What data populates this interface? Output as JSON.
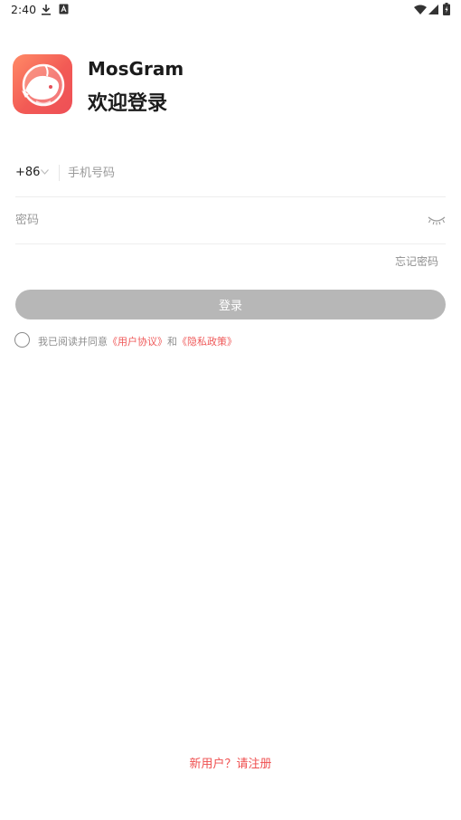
{
  "status_bar": {
    "time": "2:40",
    "left_icons": [
      "download-icon",
      "keyboard-a-icon"
    ],
    "right_icons": [
      "wifi-icon",
      "signal-icon",
      "battery-charging-icon"
    ]
  },
  "header": {
    "app_name": "MosGram",
    "welcome": "欢迎登录",
    "logo_colors": [
      "#ff8a66",
      "#ee4f57"
    ]
  },
  "form": {
    "country_code": "+86",
    "phone_placeholder": "手机号码",
    "password_placeholder": "密码",
    "forgot_password": "忘记密码",
    "login_label": "登录",
    "login_button_color": "#b7b7b7"
  },
  "agreement": {
    "checked": false,
    "prefix": "我已阅读并同意",
    "user_agreement": "《用户协议》",
    "and": "和",
    "privacy_policy": "《隐私政策》",
    "link_color": "#ef5a5a"
  },
  "footer": {
    "register_prefix": "新用户？",
    "register_link": "请注册",
    "accent": "#ef4f4f"
  }
}
